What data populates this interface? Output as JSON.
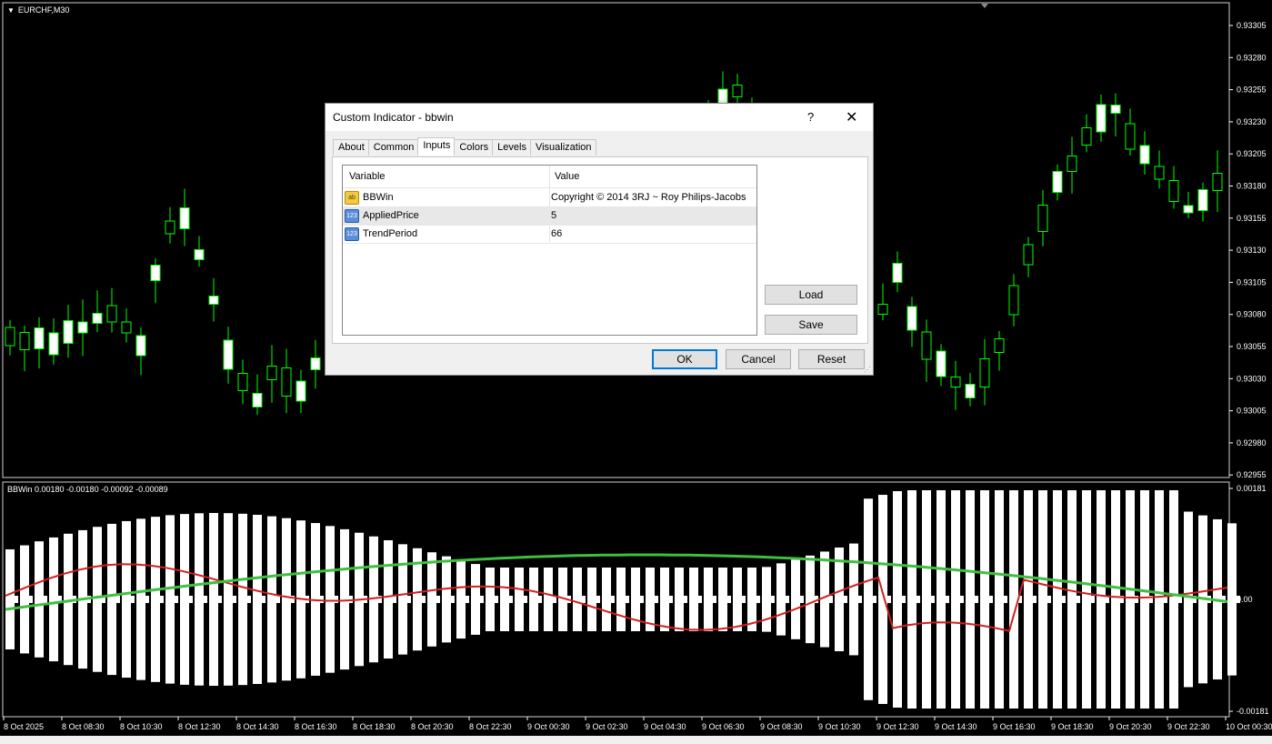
{
  "chart": {
    "symbol_label": "EURCHF,M30",
    "price_ticks": [
      "0.93305",
      "0.93280",
      "0.93255",
      "0.93230",
      "0.93205",
      "0.93180",
      "0.93155",
      "0.93130",
      "0.93105",
      "0.93080",
      "0.93055",
      "0.93030",
      "0.93005",
      "0.92980",
      "0.92955"
    ],
    "time_ticks": [
      "8 Oct 2025",
      "8 Oct 08:30",
      "8 Oct 10:30",
      "8 Oct 12:30",
      "8 Oct 14:30",
      "8 Oct 16:30",
      "8 Oct 18:30",
      "8 Oct 20:30",
      "8 Oct 22:30",
      "9 Oct 00:30",
      "9 Oct 02:30",
      "9 Oct 04:30",
      "9 Oct 06:30",
      "9 Oct 08:30",
      "9 Oct 10:30",
      "9 Oct 12:30",
      "9 Oct 14:30",
      "9 Oct 16:30",
      "9 Oct 18:30",
      "9 Oct 20:30",
      "9 Oct 22:30",
      "10 Oct 00:30"
    ],
    "colors": {
      "background": "#000000",
      "bull": "#00ff00",
      "bear": "#ffffff",
      "grid_text": "#ffffff"
    }
  },
  "indicator": {
    "label": "BBWin 0.00180 -0.00180 -0.00092 -0.00089",
    "scale_ticks": [
      "0.00181",
      "0.00",
      "-0.00181"
    ],
    "colors": {
      "bars": "#ffffff",
      "red_line": "#d21f1f",
      "green_line": "#3fbf3f"
    }
  },
  "dialog": {
    "title": "Custom Indicator - bbwin",
    "help": "?",
    "close": "✕",
    "tabs": [
      "About",
      "Common",
      "Inputs",
      "Colors",
      "Levels",
      "Visualization"
    ],
    "active_tab": "Inputs",
    "columns": {
      "variable": "Variable",
      "value": "Value"
    },
    "rows": [
      {
        "icon": "ab",
        "name": "BBWin",
        "value": "Copyright © 2014 3RJ ~ Roy Philips-Jacobs"
      },
      {
        "icon": "123",
        "name": "AppliedPrice",
        "value": "5"
      },
      {
        "icon": "123",
        "name": "TrendPeriod",
        "value": "66"
      }
    ],
    "buttons": {
      "load": "Load",
      "save": "Save",
      "ok": "OK",
      "cancel": "Cancel",
      "reset": "Reset"
    }
  }
}
